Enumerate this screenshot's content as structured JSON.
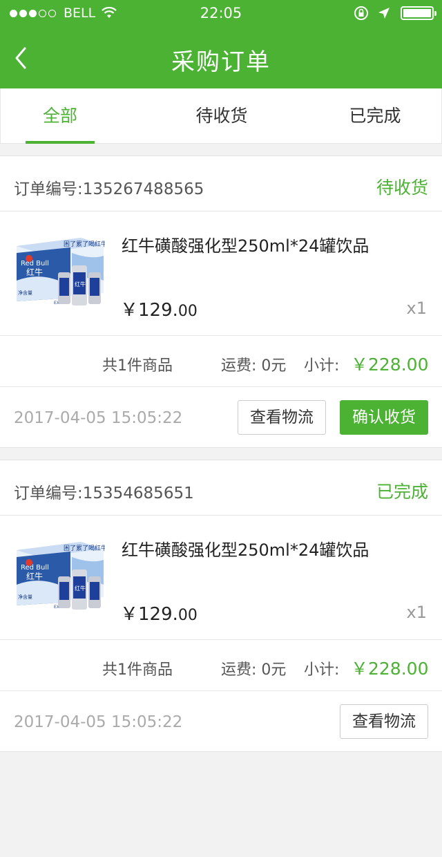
{
  "status_bar": {
    "carrier": "BELL",
    "time": "22:05",
    "signal_dots_filled": 3,
    "signal_dots_total": 5
  },
  "nav": {
    "title": "采购订单",
    "back_icon": "chevron-left-icon"
  },
  "tabs": [
    {
      "label": "全部",
      "active": true
    },
    {
      "label": "待收货",
      "active": false
    },
    {
      "label": "已完成",
      "active": false
    }
  ],
  "orders": [
    {
      "order_no_label": "订单编号:",
      "order_no": "135267488565",
      "status": "待收货",
      "product_name": "红牛磺酸强化型250ml*24罐饮品",
      "price_main": "￥129.",
      "price_cents": "00",
      "quantity": "x1",
      "item_count": "共1件商品",
      "freight": "运费: 0元",
      "subtotal_label": "小计:",
      "subtotal": "￥228.00",
      "datetime": "2017-04-05  15:05:22",
      "buttons": [
        "查看物流",
        "确认收货"
      ]
    },
    {
      "order_no_label": "订单编号:",
      "order_no": "15354685651",
      "status": "已完成",
      "product_name": "红牛磺酸强化型250ml*24罐饮品",
      "price_main": "￥129.",
      "price_cents": "00",
      "quantity": "x1",
      "item_count": "共1件商品",
      "freight": "运费: 0元",
      "subtotal_label": "小计:",
      "subtotal": "￥228.00",
      "datetime": "2017-04-05  15:05:22",
      "buttons": [
        "查看物流"
      ]
    }
  ],
  "product_image": {
    "box_text": "Red Bull",
    "box_text_cn": "红牛",
    "box_slogan": "困了累了喝红牛",
    "box_label": "净含量",
    "can_text": "红牛",
    "can_text_en": "Red Bull",
    "box_extra": "EXTRA"
  },
  "colors": {
    "accent": "#4cb234",
    "background": "#f2f2f2"
  }
}
